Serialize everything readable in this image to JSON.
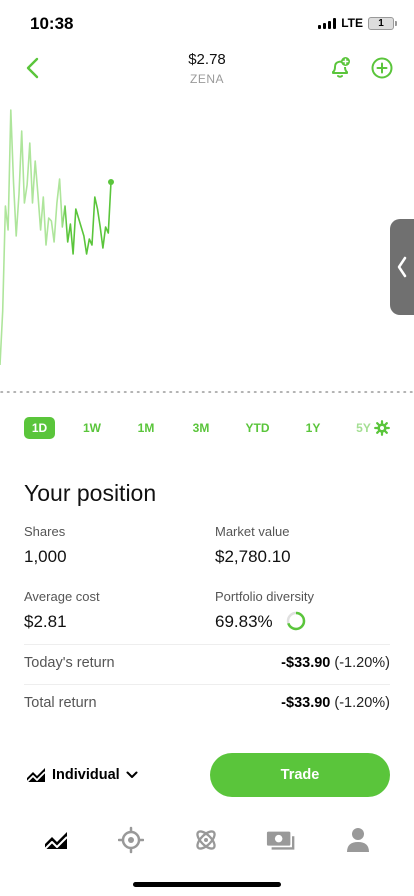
{
  "status_bar": {
    "time": "10:38",
    "network": "LTE",
    "battery": "1"
  },
  "header": {
    "price": "$2.78",
    "symbol": "ZENA"
  },
  "icons": {
    "back": "chevron-left-icon",
    "alert": "bell-plus-icon",
    "add": "circle-plus-icon",
    "handle": "chevron-left-icon",
    "settings": "gear-icon",
    "account": "chart-line-icon",
    "dropdown": "chevron-down-icon",
    "tabs": [
      "chart-line-icon",
      "radar-icon",
      "browse-icon",
      "cash-icon",
      "account-icon"
    ]
  },
  "colors": {
    "accent": "#5ac53b",
    "chart_line": "#5ac53b",
    "chart_line_faded": "#aee59b"
  },
  "chart_data": {
    "type": "line",
    "title": "",
    "xlabel": "",
    "ylabel": "",
    "grid": false,
    "ylim": [
      0,
      1
    ],
    "series": [
      {
        "values": [
          0.09,
          0.27,
          0.62,
          0.54,
          0.94,
          0.7,
          0.52,
          0.66,
          0.87,
          0.63,
          0.69,
          0.83,
          0.63,
          0.77,
          0.66,
          0.54,
          0.65,
          0.49,
          0.58,
          0.57,
          0.5,
          0.63,
          0.71,
          0.55,
          0.62,
          0.5,
          0.56,
          0.46,
          0.61,
          0.58,
          0.55,
          0.52,
          0.46,
          0.51,
          0.49,
          0.65,
          0.61,
          0.55,
          0.48,
          0.55,
          0.53,
          0.7
        ],
        "current_point_index": 41
      }
    ]
  },
  "range_tabs": [
    {
      "label": "1D",
      "active": true
    },
    {
      "label": "1W",
      "active": false
    },
    {
      "label": "1M",
      "active": false
    },
    {
      "label": "3M",
      "active": false
    },
    {
      "label": "YTD",
      "active": false
    },
    {
      "label": "1Y",
      "active": false
    },
    {
      "label": "5Y",
      "active": false
    }
  ],
  "position": {
    "title": "Your position",
    "shares_label": "Shares",
    "shares_value": "1,000",
    "market_value_label": "Market value",
    "market_value": "$2,780.10",
    "avg_cost_label": "Average cost",
    "avg_cost_value": "$2.81",
    "diversity_label": "Portfolio diversity",
    "diversity_value": "69.83%",
    "diversity_fraction": 0.6983,
    "todays_return_label": "Today's return",
    "todays_return_amount": "-$33.90",
    "todays_return_pct": "(-1.20%)",
    "total_return_label": "Total return",
    "total_return_amount": "-$33.90",
    "total_return_pct": "(-1.20%)"
  },
  "account": {
    "label": "Individual"
  },
  "trade": {
    "label": "Trade"
  }
}
